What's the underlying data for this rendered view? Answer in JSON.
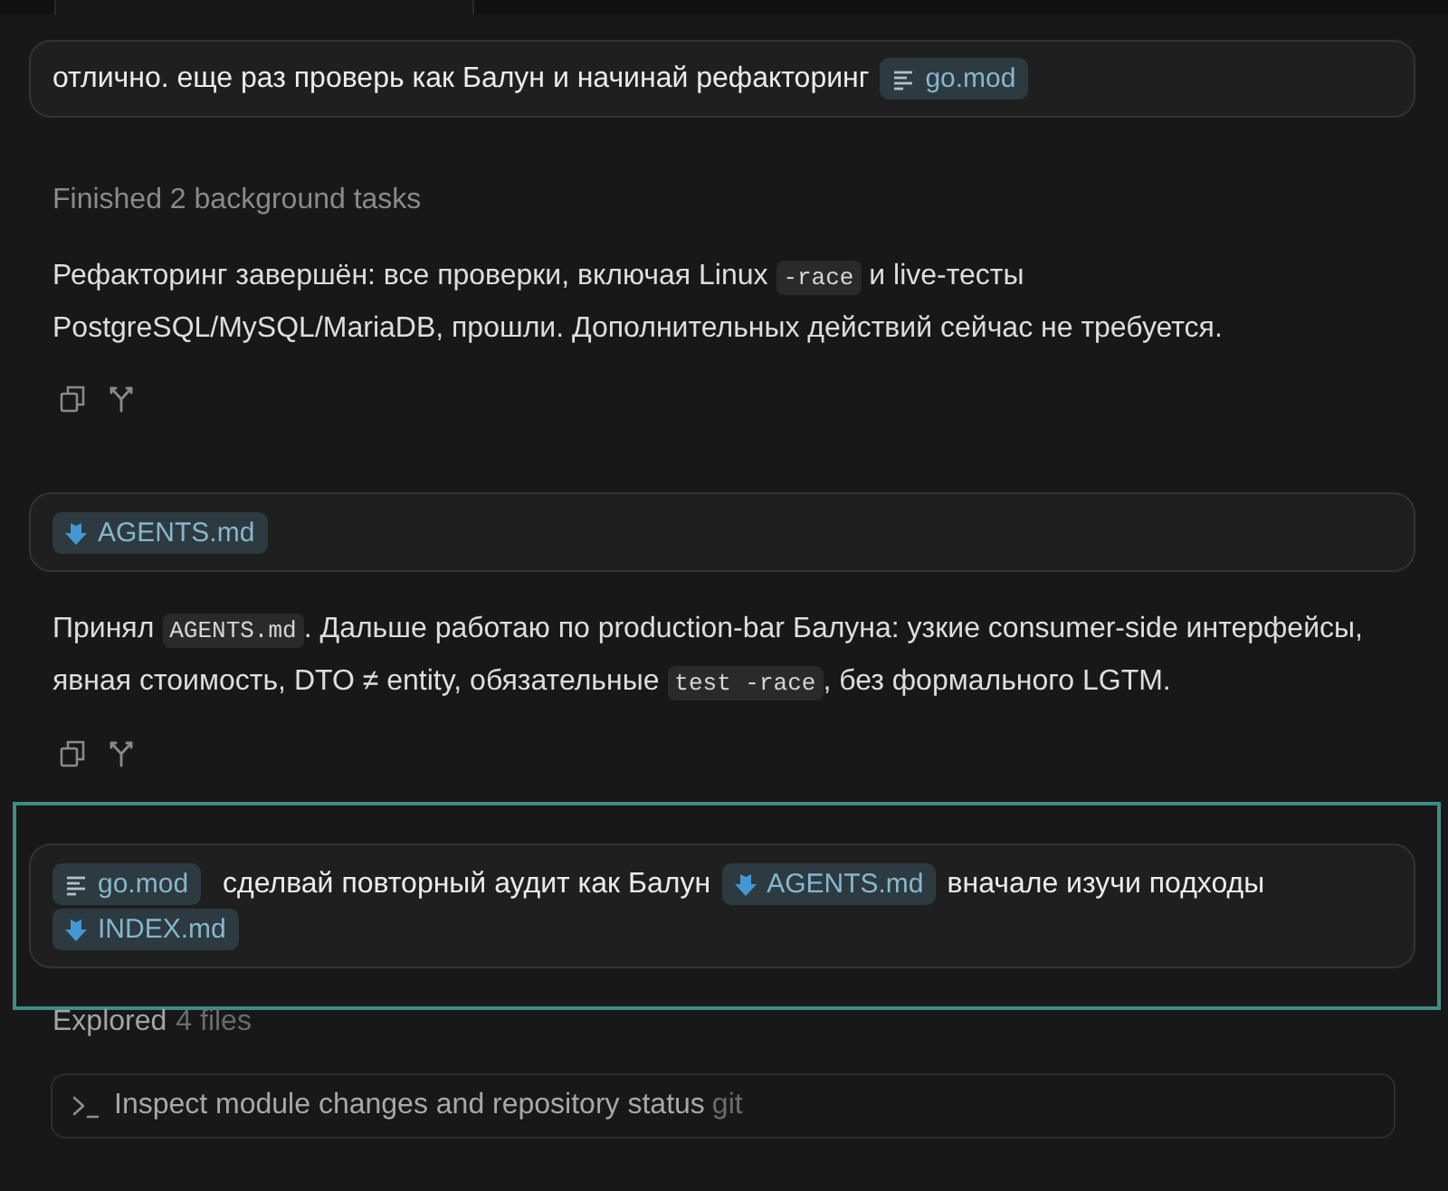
{
  "pinned_message": {
    "segments": [
      {
        "kind": "text",
        "text": "отлично. еще раз проверь как Балун и начинай рефакторинг"
      },
      {
        "kind": "module",
        "text": "go.mod"
      }
    ]
  },
  "feed": [
    {
      "kind": "status",
      "text": "Finished 2 background tasks"
    },
    {
      "kind": "reply",
      "segments": [
        {
          "kind": "text",
          "text": "Рефакторинг завершён: все проверки, включая Linux "
        },
        {
          "kind": "code",
          "text": "-race"
        },
        {
          "kind": "text",
          "text": " и live-тесты PostgreSQL/MySQL/MariaDB, прошли. Дополнительных действий сейчас не требуется."
        }
      ]
    },
    {
      "kind": "user_message",
      "selected": false,
      "segments": [
        {
          "kind": "markdown",
          "text": "AGENTS.md"
        }
      ]
    },
    {
      "kind": "reply",
      "segments": [
        {
          "kind": "text",
          "text": "Принял "
        },
        {
          "kind": "code",
          "text": "AGENTS.md"
        },
        {
          "kind": "text",
          "text": ". Дальше работаю по production-bar Балуна: узкие consumer-side интерфейсы, явная стоимость, DTO ≠ entity, обязательные "
        },
        {
          "kind": "code",
          "text": "test -race"
        },
        {
          "kind": "text",
          "text": ", без формального LGTM."
        }
      ]
    },
    {
      "kind": "user_message",
      "selected": true,
      "segments": [
        {
          "kind": "module",
          "text": "go.mod"
        },
        {
          "kind": "text",
          "text": "сделвай повторный аудит как Балун"
        },
        {
          "kind": "markdown",
          "text": "AGENTS.md"
        },
        {
          "kind": "text",
          "text": "вначале изучи подходы"
        },
        {
          "kind": "markdown",
          "text": "INDEX.md"
        }
      ]
    },
    {
      "kind": "explored",
      "label": "Explored",
      "detail": "4 files"
    },
    {
      "kind": "command",
      "text": "Inspect module changes and repository status",
      "tool": "git"
    }
  ]
}
